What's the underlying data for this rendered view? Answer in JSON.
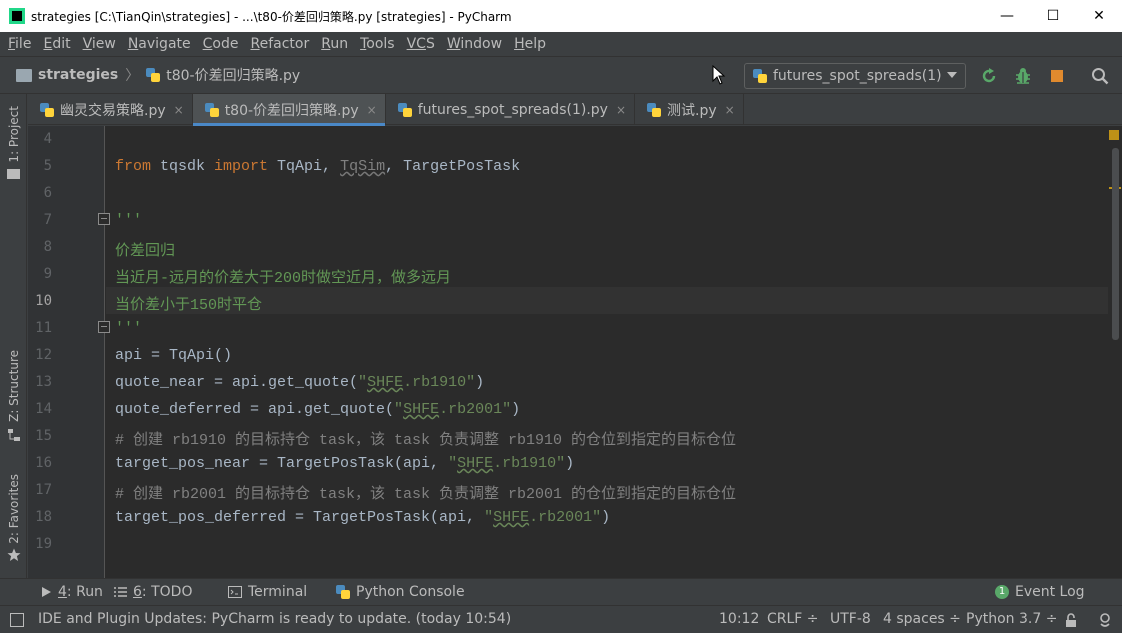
{
  "window": {
    "title": "strategies [C:\\TianQin\\strategies] - ...\\t80-价差回归策略.py [strategies] - PyCharm",
    "minimize": "—",
    "maximize": "☐",
    "close": "✕"
  },
  "menu": {
    "items": [
      {
        "mnemonic": "F",
        "rest": "ile"
      },
      {
        "mnemonic": "E",
        "rest": "dit"
      },
      {
        "mnemonic": "V",
        "rest": "iew"
      },
      {
        "mnemonic": "N",
        "rest": "avigate"
      },
      {
        "mnemonic": "C",
        "rest": "ode"
      },
      {
        "mnemonic": "R",
        "rest": "efactor"
      },
      {
        "mnemonic": "R",
        "rest": "un"
      },
      {
        "mnemonic": "T",
        "rest": "ools"
      },
      {
        "mnemonic": "VC",
        "rest": "S"
      },
      {
        "mnemonic": "W",
        "rest": "indow"
      },
      {
        "mnemonic": "H",
        "rest": "elp"
      }
    ]
  },
  "breadcrumb": {
    "project": "strategies",
    "separator": "〉",
    "file": "t80-价差回归策略.py"
  },
  "run_config": {
    "selected": "futures_spot_spreads(1)"
  },
  "left_strip": {
    "project_tab": "1: Project",
    "structure_tab": "Z: Structure",
    "favorites_tab": "2: Favorites"
  },
  "tabs": [
    {
      "label": "幽灵交易策略.py",
      "active": false
    },
    {
      "label": "t80-价差回归策略.py",
      "active": true
    },
    {
      "label": "futures_spot_spreads(1).py",
      "active": false
    },
    {
      "label": "测试.py",
      "active": false
    }
  ],
  "tab_close": "×",
  "editor": {
    "line_numbers": [
      "4",
      "5",
      "6",
      "7",
      "8",
      "9",
      "10",
      "11",
      "12",
      "13",
      "14",
      "15",
      "16",
      "17",
      "18",
      "19"
    ],
    "current_line": "10",
    "lines": {
      "l5": {
        "kw1": "from",
        "mod": " tqsdk ",
        "kw2": "import",
        "rest1": " TqApi, ",
        "sim": "TqSim",
        "rest2": ", TargetPosTask"
      },
      "l7": {
        "doc": "'''"
      },
      "l8": {
        "doc": "价差回归"
      },
      "l9": {
        "doc": "当近月-远月的价差大于200时做空近月，做多远月"
      },
      "l10": {
        "doc": "当价差小于150时平仓"
      },
      "l11": {
        "doc": "'''"
      },
      "l12": {
        "code": "api = TqApi()"
      },
      "l13": {
        "pre": "quote_near = api.get_quote(",
        "q1": "\"",
        "sq": "SHFE",
        "str": ".rb1910\"",
        "post": ")"
      },
      "l14": {
        "pre": "quote_deferred = api.get_quote(",
        "q1": "\"",
        "sq": "SHFE",
        "str": ".rb2001\"",
        "post": ")"
      },
      "l15": {
        "cmt": "# 创建 rb1910 的目标持仓 task，该 task 负责调整 rb1910 的仓位到指定的目标仓位"
      },
      "l16": {
        "pre": "target_pos_near = TargetPosTask(api, ",
        "q1": "\"",
        "sq": "SHFE",
        "str": ".rb1910\"",
        "post": ")"
      },
      "l17": {
        "cmt": "# 创建 rb2001 的目标持仓 task，该 task 负责调整 rb2001 的仓位到指定的目标仓位"
      },
      "l18": {
        "pre": "target_pos_deferred = TargetPosTask(api, ",
        "q1": "\"",
        "sq": "SHFE",
        "str": ".rb2001\"",
        "post": ")"
      }
    }
  },
  "tool_windows": {
    "run_num": "4",
    "run_label": ": Run",
    "todo_num": "6",
    "todo_label": ": TODO",
    "terminal": "Terminal",
    "python_console": "Python Console",
    "event_log_count": "1",
    "event_log": "Event Log"
  },
  "status": {
    "message": "IDE and Plugin Updates: PyCharm is ready to update. (today 10:54)",
    "position": "10:12",
    "line_sep": "CRLF ÷",
    "encoding": "UTF-8",
    "indent": "4 spaces ÷",
    "interpreter": "Python 3.7 ÷"
  },
  "colors": {
    "keyword": "#cc7832",
    "string": "#6a8759",
    "docstring": "#629755",
    "comment": "#808080",
    "text": "#a9b7c6",
    "accent": "#4a88c7"
  }
}
